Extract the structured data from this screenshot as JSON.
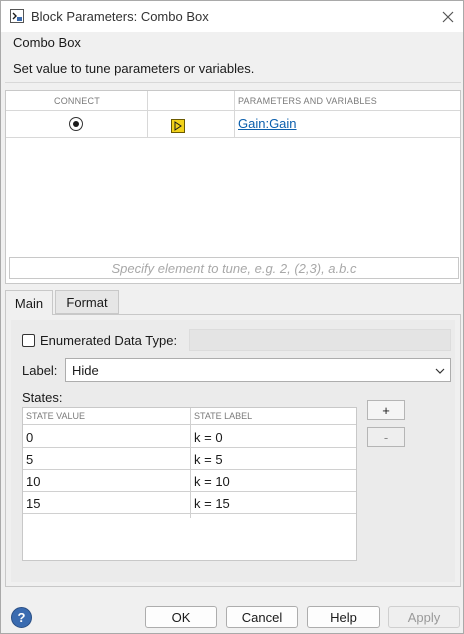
{
  "window": {
    "title": "Block Parameters: Combo Box"
  },
  "description": {
    "title": "Combo Box",
    "text": "Set value to tune parameters or variables."
  },
  "connection": {
    "col_connect": "CONNECT",
    "col_params": "PARAMETERS AND VARIABLES",
    "rows": [
      {
        "connected": true,
        "param": "Gain:Gain"
      }
    ],
    "filter_placeholder": "Specify element to tune, e.g. 2, (2,3), a.b.c"
  },
  "tabs": [
    {
      "label": "Main",
      "active": true
    },
    {
      "label": "Format",
      "active": false
    }
  ],
  "main": {
    "enumerated_label": "Enumerated Data Type:",
    "enumerated_checked": false,
    "label_label": "Label:",
    "label_value": "Hide",
    "states_title": "States:",
    "col_value": "STATE VALUE",
    "col_label": "STATE LABEL",
    "states": [
      {
        "value": "0",
        "label": "k = 0"
      },
      {
        "value": "5",
        "label": "k = 5"
      },
      {
        "value": "10",
        "label": "k = 10"
      },
      {
        "value": "15",
        "label": "k = 15"
      }
    ],
    "add_label": "+",
    "remove_label": "-"
  },
  "footer": {
    "ok": "OK",
    "cancel": "Cancel",
    "help": "Help",
    "apply": "Apply",
    "help_glyph": "?"
  },
  "colors": {
    "link": "#0b5fad",
    "help_icon": "#3a6bb0",
    "block_icon": "#f2d21a"
  }
}
